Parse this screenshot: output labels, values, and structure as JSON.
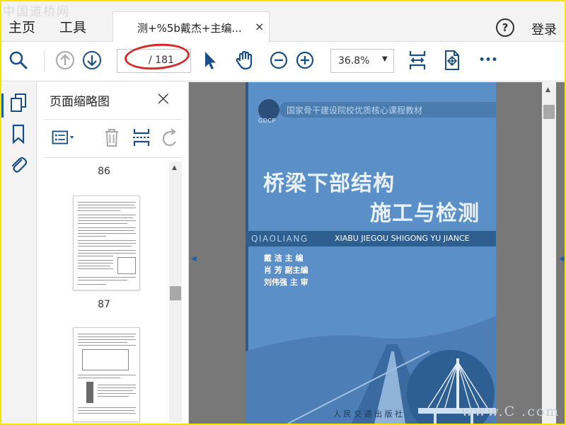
{
  "watermark": {
    "top": "中国道桥网",
    "bottom": "www.C    .com"
  },
  "tabbar": {
    "home_label": "主页",
    "tools_label": "工具",
    "doc_tab_title": "测+%5b戴杰+主编...",
    "close_glyph": "×",
    "help_glyph": "?",
    "login_label": "登录"
  },
  "toolbar": {
    "icons": [
      "search-icon",
      "page-up-icon",
      "page-down-icon",
      "select-cursor-icon",
      "hand-tool-icon",
      "zoom-out-icon",
      "zoom-in-icon",
      "fit-page-icon",
      "full-screen-icon",
      "more-icon"
    ],
    "page_current": "",
    "page_total": "/ 181",
    "zoom_value": "36.8%",
    "zoom_caret": "▼",
    "more_glyph": "•••",
    "highlight_color": "#d42a2a"
  },
  "leftrail": {
    "icons": [
      "thumbnails-icon",
      "bookmark-icon",
      "attachment-icon"
    ],
    "accent_color": "#1a5fb4"
  },
  "thumbnail_panel": {
    "title": "页面缩略图",
    "close_glyph": "×",
    "tools": [
      "page-options-icon",
      "delete-page-icon",
      "extract-page-icon",
      "rotate-page-icon"
    ],
    "pages": [
      {
        "number": "86"
      },
      {
        "number": "87"
      }
    ]
  },
  "document": {
    "series": "国家骨干建设院校优质核心课程教材",
    "gdcp": "GDCP",
    "title_line1": "桥梁下部结构",
    "title_line2": "施工与检测",
    "pinyin_a": "QIAOLIANG",
    "pinyin_b": "XIABU JIEGOU SHIGONG YU JIANCE",
    "authors": [
      {
        "text": "戴  洁  主  编"
      },
      {
        "text": "肖  芳  副主编"
      },
      {
        "text": "刘伟强  主  审"
      }
    ],
    "publisher": "人 民 交 通 出 版 社"
  }
}
